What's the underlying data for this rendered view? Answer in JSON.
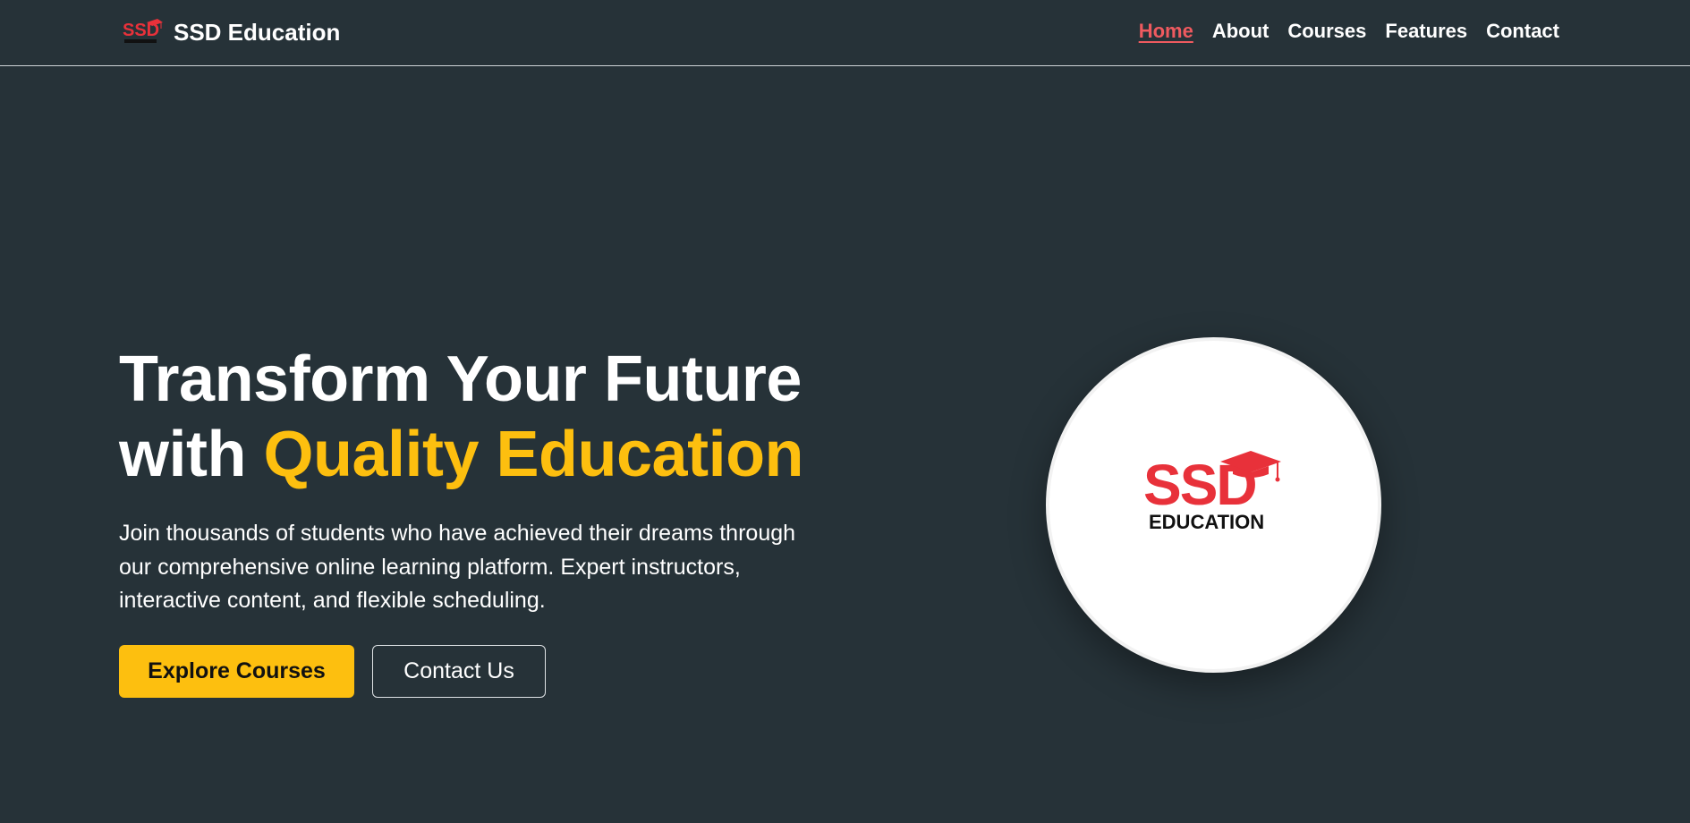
{
  "brand": {
    "name": "SSD Education",
    "logo_text": "SSD",
    "logo_subtext": "EDUCATION"
  },
  "nav": {
    "items": [
      {
        "label": "Home",
        "active": true
      },
      {
        "label": "About",
        "active": false
      },
      {
        "label": "Courses",
        "active": false
      },
      {
        "label": "Features",
        "active": false
      },
      {
        "label": "Contact",
        "active": false
      }
    ]
  },
  "hero": {
    "title_line1": "Transform Your Future",
    "title_line2_prefix": "with ",
    "title_line2_accent": "Quality Education",
    "description": "Join thousands of students who have achieved their dreams through our comprehensive online learning platform. Expert instructors, interactive content, and flexible scheduling.",
    "primary_button": "Explore Courses",
    "secondary_button": "Contact Us"
  },
  "colors": {
    "background": "#263238",
    "accent_yellow": "#fdbf0f",
    "nav_active": "#ef5a5f",
    "logo_red": "#e8313a"
  }
}
